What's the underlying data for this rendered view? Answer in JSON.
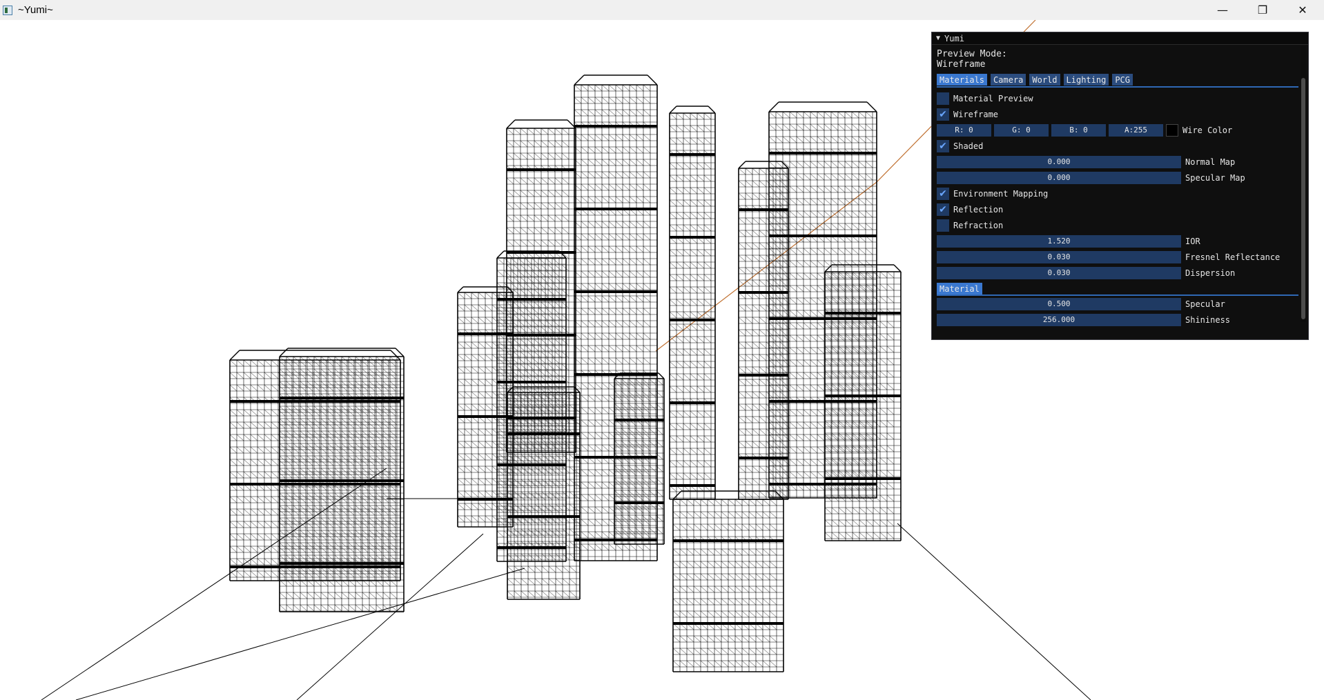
{
  "window": {
    "title": "~Yumi~",
    "controls": {
      "minimize": "—",
      "maximize": "❐",
      "close": "✕"
    }
  },
  "panel": {
    "title": "Yumi",
    "preview_mode_label": "Preview Mode:",
    "preview_mode_value": "Wireframe",
    "tabs": [
      {
        "label": "Materials",
        "active": true
      },
      {
        "label": "Camera",
        "active": false
      },
      {
        "label": "World",
        "active": false
      },
      {
        "label": "Lighting",
        "active": false
      },
      {
        "label": "PCG",
        "active": false
      }
    ],
    "material_preview": {
      "label": "Material Preview",
      "checked": false
    },
    "wireframe": {
      "label": "Wireframe",
      "checked": true
    },
    "wire_color": {
      "r": "R:  0",
      "g": "G:  0",
      "b": "B:  0",
      "a": "A:255",
      "label": "Wire Color",
      "swatch": "#000000"
    },
    "shaded": {
      "label": "Shaded",
      "checked": true
    },
    "normal_map": {
      "value": "0.000",
      "label": "Normal Map"
    },
    "specular_map": {
      "value": "0.000",
      "label": "Specular Map"
    },
    "environment_mapping": {
      "label": "Environment Mapping",
      "checked": true
    },
    "reflection": {
      "label": "Reflection",
      "checked": true
    },
    "refraction": {
      "label": "Refraction",
      "checked": false
    },
    "ior": {
      "value": "1.520",
      "label": "IOR"
    },
    "fresnel": {
      "value": "0.030",
      "label": "Fresnel Reflectance"
    },
    "dispersion": {
      "value": "0.030",
      "label": "Dispersion"
    },
    "material_section": "Material",
    "specular": {
      "value": "0.500",
      "label": "Specular"
    },
    "shininess": {
      "value": "256.000",
      "label": "Shininess"
    },
    "check_glyph": "✔"
  },
  "colors": {
    "panel_bg": "#0f0f0f",
    "widget_bg": "#1f3a63",
    "tab_active": "#3a78d0",
    "wire": "#000000",
    "axis_line": "#c07030"
  }
}
